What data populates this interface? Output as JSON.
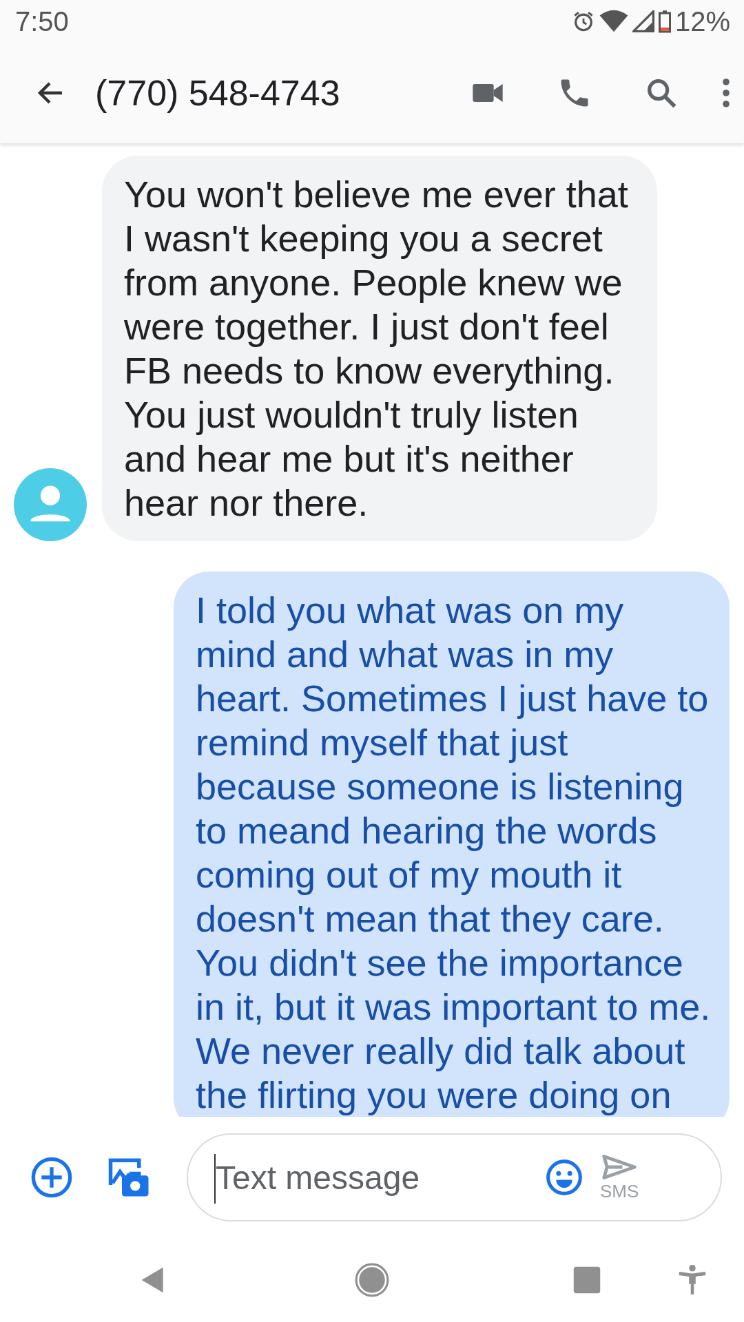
{
  "status_bar": {
    "time": "7:50",
    "battery": "12%"
  },
  "header": {
    "title": "(770) 548-4743"
  },
  "messages": [
    {
      "kind": "incoming",
      "text": "You won't believe me ever that I wasn't keeping you a secret from anyone. People knew we were together. I just don't feel FB needs to know everything. You just wouldn't truly listen and hear me but it's neither hear nor there."
    },
    {
      "kind": "outgoing",
      "text": "I told you what was on my mind and what was in my heart. Sometimes I just have to remind myself that just because someone is listening to meand hearing the words coming out of my mouth it doesn't mean that they care. You didn't see the importance in it, but it was important to me.\nWe never really did talk about the flirting you were doing on"
    }
  ],
  "compose": {
    "placeholder": "Text message",
    "send_label": "SMS"
  }
}
